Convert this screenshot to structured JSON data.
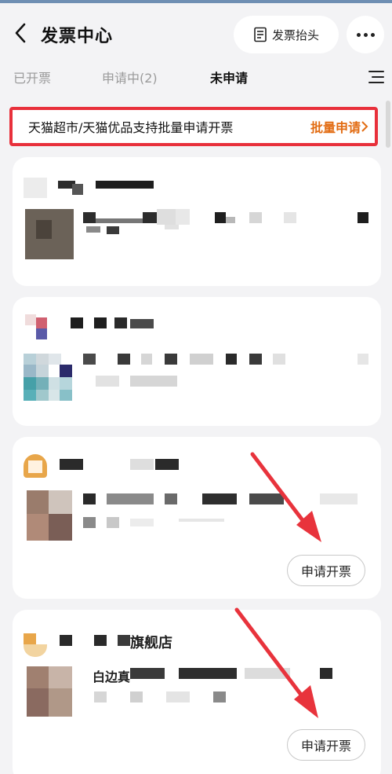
{
  "header": {
    "title": "发票中心",
    "invoice_header_label": "发票抬头"
  },
  "tabs": [
    {
      "label": "已开票",
      "active": false
    },
    {
      "label": "申请中(2)",
      "active": false
    },
    {
      "label": "未申请",
      "active": true
    }
  ],
  "banner": {
    "text": "天猫超市/天猫优品支持批量申请开票",
    "link_label": "批量申请"
  },
  "cards": [
    {
      "shop_name_fragment": ""
    },
    {
      "shop_name_fragment": ""
    },
    {
      "shop_name_fragment": "",
      "apply_label": "申请开票"
    },
    {
      "shop_name_fragment": "旗舰店",
      "product_fragment": "白边真",
      "apply_label": "申请开票"
    }
  ],
  "colors": {
    "accent_orange": "#e26c12",
    "highlight_red": "#e8303b",
    "annotation_arrow": "#e8333c"
  }
}
